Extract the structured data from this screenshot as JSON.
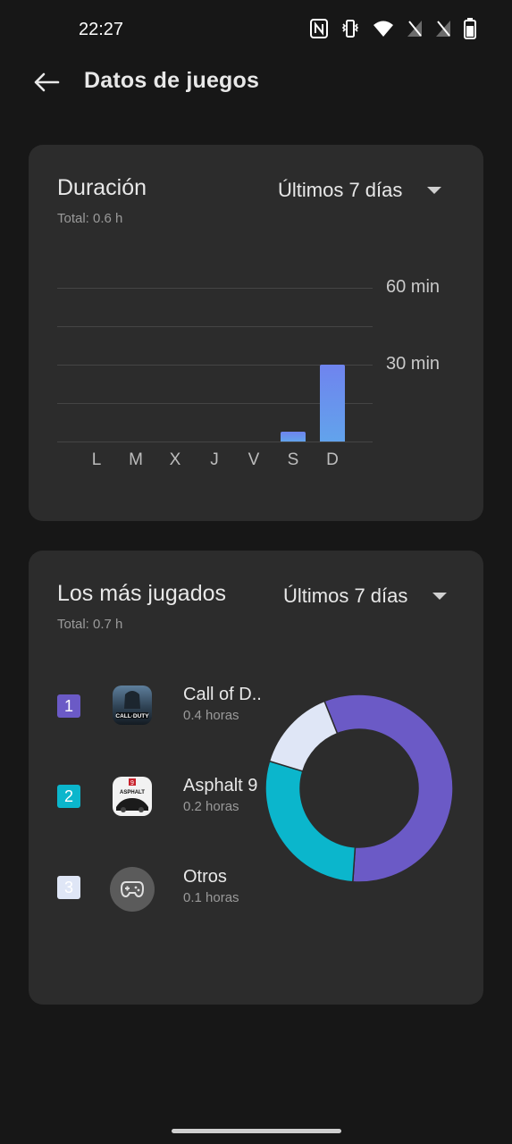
{
  "status_bar": {
    "time": "22:27",
    "icons": [
      "nfc-icon",
      "vibrate-icon",
      "wifi-icon",
      "no-signal-icon",
      "no-signal-icon",
      "battery-icon"
    ]
  },
  "header": {
    "title": "Datos de juegos",
    "back_icon": "arrow-left-icon"
  },
  "duration_card": {
    "title": "Duración",
    "total": "Total: 0.6 h",
    "period": "Últimos 7 días"
  },
  "chart_data": {
    "type": "bar",
    "categories": [
      "L",
      "M",
      "X",
      "J",
      "V",
      "S",
      "D"
    ],
    "values": [
      0,
      0,
      0,
      0,
      0,
      4,
      30
    ],
    "y_ticks": [
      "60 min",
      "30 min"
    ],
    "ylim": [
      0,
      60
    ],
    "ylabel": "",
    "xlabel": "",
    "bar_color": "#6f84ee",
    "bar_color_bottom": "#62a3ec",
    "grid": true
  },
  "most_played_card": {
    "title": "Los más jugados",
    "total": "Total: 0.7 h",
    "period": "Últimos 7 días",
    "items": [
      {
        "rank": "1",
        "name": "Call of D..",
        "hours": "0.4 horas",
        "color": "#6b5ac6",
        "icon": "call-of-duty-icon"
      },
      {
        "rank": "2",
        "name": "Asphalt 9",
        "hours": "0.2 horas",
        "color": "#0bb6cc",
        "icon": "asphalt-9-icon"
      },
      {
        "rank": "3",
        "name": "Otros",
        "hours": "0.1 horas",
        "color": "#dfe6f6",
        "icon": "gamepad-icon"
      }
    ],
    "donut": [
      {
        "name": "Call of D..",
        "value": 0.4,
        "color": "#6b5ac6"
      },
      {
        "name": "Asphalt 9",
        "value": 0.2,
        "color": "#0bb6cc"
      },
      {
        "name": "Otros",
        "value": 0.1,
        "color": "#dfe6f6"
      }
    ]
  }
}
